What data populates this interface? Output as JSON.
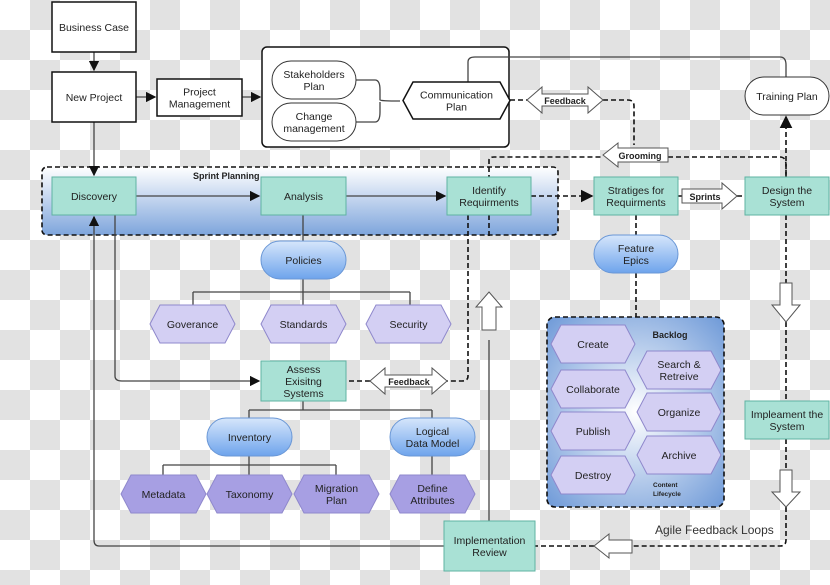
{
  "nodes": {
    "business_case": [
      "Business Case"
    ],
    "new_project": [
      "New Project"
    ],
    "project_management": [
      "Project",
      "Management"
    ],
    "stakeholders_plan": [
      "Stakeholders",
      "Plan"
    ],
    "change_management": [
      "Change",
      "management"
    ],
    "communication_plan": [
      "Communication",
      "Plan"
    ],
    "training_plan": [
      "Training Plan"
    ],
    "discovery": [
      "Discovery"
    ],
    "analysis": [
      "Analysis"
    ],
    "identify_requirments": [
      "Identify",
      "Requirments"
    ],
    "stratiges_for_requirments": [
      "Stratiges for",
      "Requirments"
    ],
    "design_the_system": [
      "Design the",
      "System"
    ],
    "feature_epics": [
      "Feature",
      "Epics"
    ],
    "policies": [
      "Policies"
    ],
    "goverance": [
      "Goverance"
    ],
    "standards": [
      "Standards"
    ],
    "security": [
      "Security"
    ],
    "assess_exisiting_systems": [
      "Assess",
      "Exisitng",
      "Systems"
    ],
    "inventory": [
      "Inventory"
    ],
    "logical_data_model": [
      "Logical",
      "Data Model"
    ],
    "metadata": [
      "Metadata"
    ],
    "taxonomy": [
      "Taxonomy"
    ],
    "migration_plan": [
      "Migration",
      "Plan"
    ],
    "define_attributes": [
      "Define",
      "Attributes"
    ],
    "create": [
      "Create"
    ],
    "collaborate": [
      "Collaborate"
    ],
    "publish": [
      "Publish"
    ],
    "destroy": [
      "Destroy"
    ],
    "search_retreive": [
      "Search &",
      "Retreive"
    ],
    "organize": [
      "Organize"
    ],
    "archive": [
      "Archive"
    ],
    "impleament_the_system": [
      "Impleament the",
      "System"
    ],
    "implementation_review": [
      "Implementation",
      "Review"
    ]
  },
  "labels": {
    "sprint_planning": "Sprint Planning",
    "backlog": "Backlog",
    "content_lifecycle": [
      "Content",
      "Lifecycle"
    ],
    "agile_feedback_loops": "Agile Feedback Loops",
    "feedback_top": "Feedback",
    "grooming": "Grooming",
    "sprints": "Sprints",
    "feedback_bottom": "Feedback"
  },
  "colors": {
    "process_fill": "#a9e1d5",
    "process_stroke": "#5fb3a2",
    "pill_blue": "#7fb0ee",
    "hex_light": "#d3cff3",
    "hex_dark": "#a79fe3",
    "container_gradient_end": "#7ea5dc"
  }
}
